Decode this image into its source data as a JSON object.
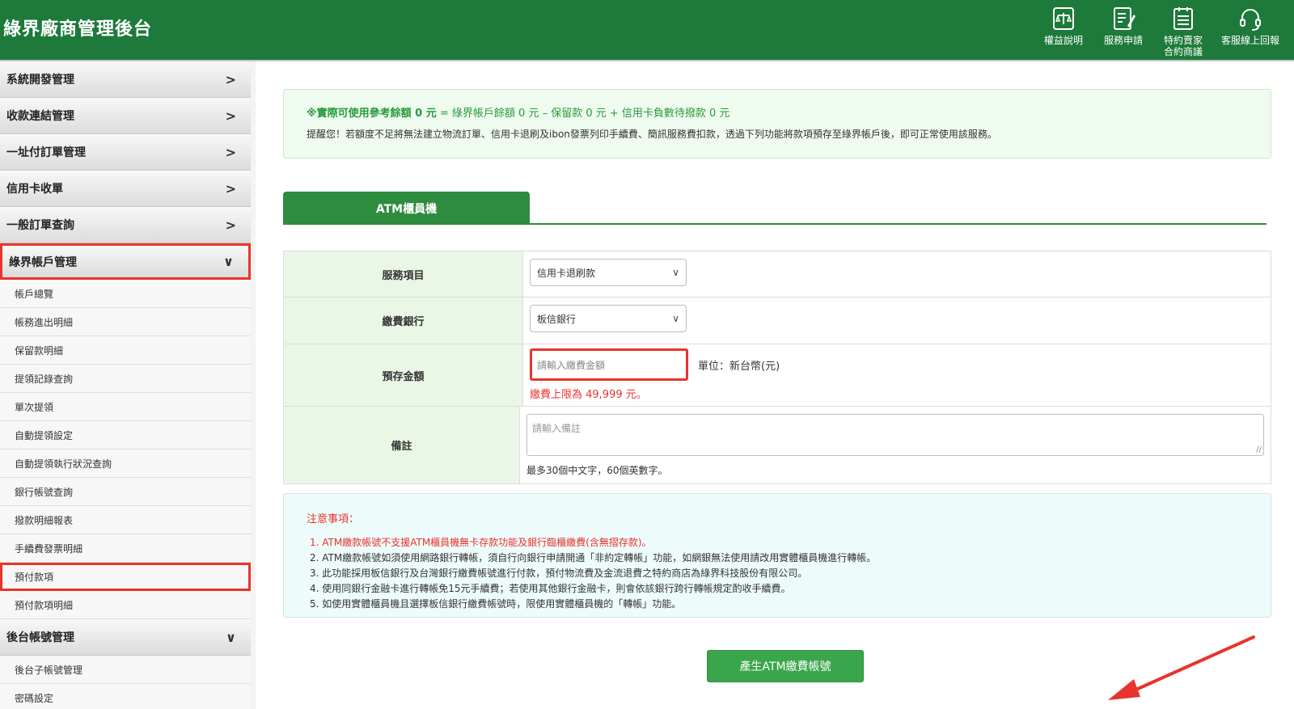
{
  "header": {
    "title": "綠界廠商管理後台",
    "nav": [
      {
        "label": "權益說明",
        "icon": "scales-icon"
      },
      {
        "label": "服務申請",
        "icon": "form-icon"
      },
      {
        "label_line1": "特約賣家",
        "label_line2": "合約商議",
        "icon": "checklist-icon"
      },
      {
        "label": "客服線上回報",
        "icon": "headset-icon"
      }
    ]
  },
  "sidebar": {
    "sections": [
      {
        "label": "系統開發管理",
        "expanded": false
      },
      {
        "label": "收款連結管理",
        "expanded": false
      },
      {
        "label": "一址付訂單管理",
        "expanded": false
      },
      {
        "label": "信用卡收單",
        "expanded": false
      },
      {
        "label": "一般訂單查詢",
        "expanded": false
      },
      {
        "label": "綠界帳戶管理",
        "expanded": true
      },
      {
        "label": "後台帳號管理",
        "expanded": true
      }
    ],
    "account_items": [
      "帳戶總覽",
      "帳務進出明細",
      "保留款明細",
      "提領記錄查詢",
      "單次提領",
      "自動提領設定",
      "自動提領執行狀況查詢",
      "銀行帳號查詢",
      "撥款明細報表",
      "手續費發票明細",
      "預付款項",
      "預付款項明細"
    ],
    "admin_items": [
      "後台子帳號管理",
      "密碼設定"
    ]
  },
  "balance": {
    "label_bold": "※實際可使用參考餘額 0 元",
    "label_rest": " = 綠界帳戶餘額 0 元 – 保留款 0 元 + 信用卡負數待撥款 0 元",
    "reminder": "提醒您！若額度不足將無法建立物流訂單、信用卡退刷及ibon發票列印手續費、簡訊服務費扣款，透過下列功能將款項預存至綠界帳戶後，即可正常使用該服務。"
  },
  "tab": {
    "label": "ATM櫃員機"
  },
  "form": {
    "service_label": "服務項目",
    "service_value": "信用卡退刷款",
    "bank_label": "繳費銀行",
    "bank_value": "板信銀行",
    "amount_label": "預存金額",
    "amount_placeholder": "請輸入繳費金額",
    "unit": "單位：新台幣(元)",
    "limit": "繳費上限為 49,999 元。",
    "note_label": "備註",
    "note_placeholder": "請輸入備註",
    "note_hint": "最多30個中文字，60個英數字。"
  },
  "notice": {
    "title": "注意事項：",
    "items": [
      "1. ATM繳款帳號不支援ATM櫃員機無卡存款功能及銀行臨櫃繳費(含無摺存款)。",
      "2. ATM繳款帳號如須使用網路銀行轉帳，須自行向銀行申請開通「非約定轉帳」功能，如網銀無法使用請改用實體櫃員機進行轉帳。",
      "3. 此功能採用板信銀行及台灣銀行繳費帳號進行付款，預付物流費及金流退費之特約商店為綠界科技股份有限公司。",
      "4. 使用同銀行金融卡進行轉帳免15元手續費；若使用其他銀行金融卡，則會依該銀行跨行轉帳規定酌收手續費。",
      "5. 如使用實體櫃員機且選擇板信銀行繳費帳號時，限使用實體櫃員機的「轉帳」功能。"
    ]
  },
  "generate_button": "產生ATM繳費帳號",
  "colors": {
    "brand": "#1d7a3a",
    "accent": "#2e8c3f",
    "warning": "#e8342c"
  }
}
